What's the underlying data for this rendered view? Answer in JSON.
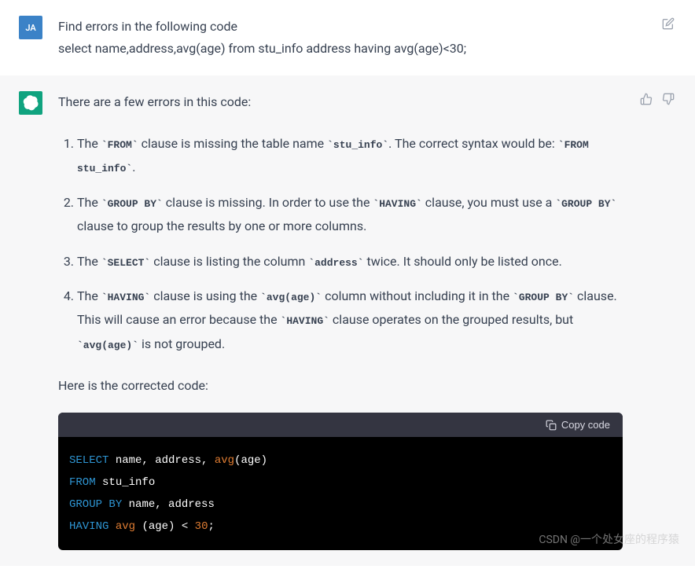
{
  "user": {
    "avatar": "JA",
    "message_line1": "Find errors in the following code",
    "message_line2": "select name,address,avg(age) from stu_info address having avg(age)<30;"
  },
  "assistant": {
    "intro": "There are a few errors in this code:",
    "items": [
      {
        "pre1": "The ",
        "code1": "`FROM`",
        "mid1": " clause is missing the table name ",
        "code2": "`stu_info`",
        "mid2": ". The correct syntax would be: ",
        "code3": "`FROM stu_info`",
        "post": "."
      },
      {
        "pre1": "The ",
        "code1": "`GROUP BY`",
        "mid1": " clause is missing. In order to use the ",
        "code2": "`HAVING`",
        "mid2": " clause, you must use a ",
        "code3": "`GROUP BY`",
        "post": " clause to group the results by one or more columns."
      },
      {
        "pre1": "The ",
        "code1": "`SELECT`",
        "mid1": " clause is listing the column ",
        "code2": "`address`",
        "post": " twice. It should only be listed once."
      },
      {
        "pre1": "The ",
        "code1": "`HAVING`",
        "mid1": " clause is using the ",
        "code2": "`avg(age)`",
        "mid2": " column without including it in the ",
        "code3": "`GROUP BY`",
        "mid3": " clause. This will cause an error because the ",
        "code4": "`HAVING`",
        "mid4": " clause operates on the grouped results, but ",
        "code5": "`avg(age)`",
        "post": " is not grouped."
      }
    ],
    "outro": "Here is the corrected code:",
    "copy_label": "Copy code",
    "code": {
      "select": "SELECT",
      "select_cols": " name, address, ",
      "avg": "avg",
      "avg_arg": "(age)",
      "from": "FROM",
      "from_table": " stu_info",
      "group": "GROUP",
      "by": " BY",
      "group_cols": " name, address",
      "having": "HAVING",
      "having_expr": " (age) < ",
      "num": "30",
      "semi": ";"
    }
  },
  "watermark": "CSDN @一个处女座的程序猿"
}
